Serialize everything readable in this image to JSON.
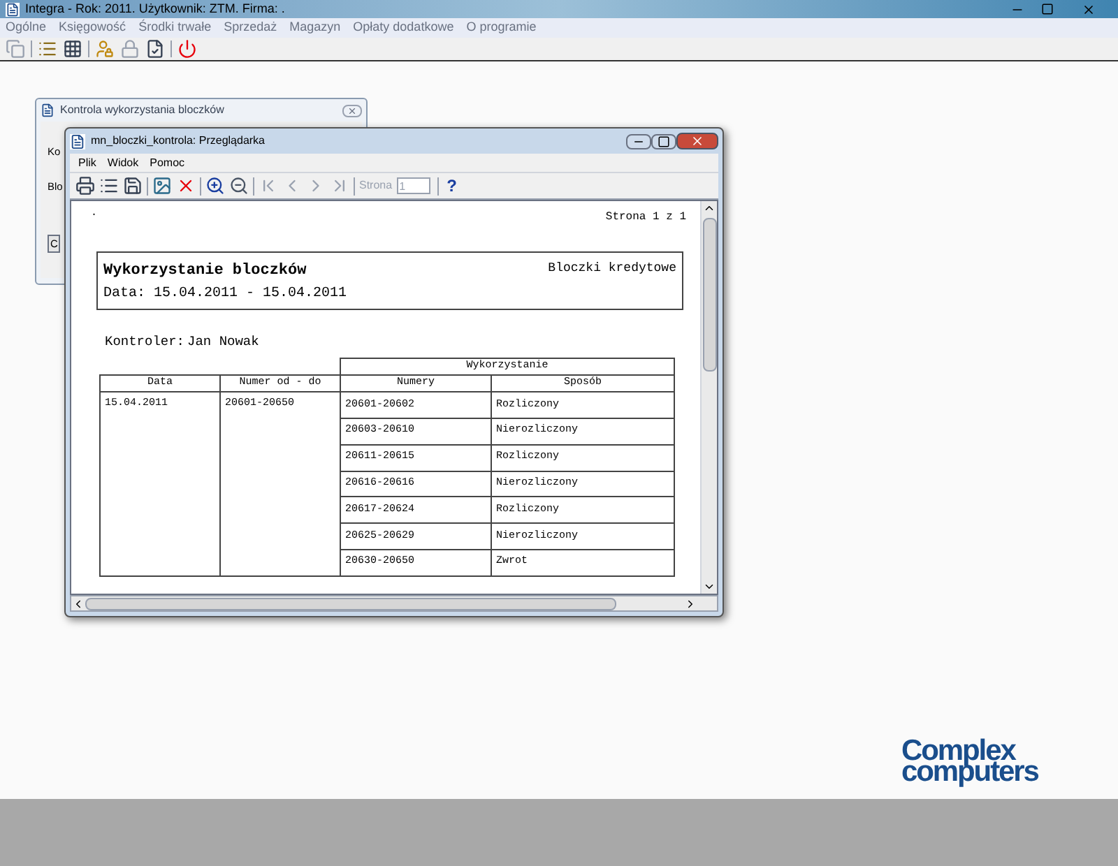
{
  "window": {
    "title": "Integra -  Rok: 2011. Użytkownik: ZTM. Firma: ."
  },
  "menu": [
    "Ogólne",
    "Księgowość",
    "Środki trwałe",
    "Sprzedaż",
    "Magazyn",
    "Opłaty dodatkowe",
    "O programie"
  ],
  "background_dialog": {
    "title": "Kontrola wykorzystania bloczków",
    "labels": [
      "Ko",
      "Blo"
    ],
    "button": "C"
  },
  "preview": {
    "title": "mn_bloczki_kontrola: Przeglądarka",
    "menu": [
      "Plik",
      "Widok",
      "Pomoc"
    ],
    "navigation": {
      "disabled": true
    },
    "page_label": "Strona",
    "page_value": "1",
    "help": "?",
    "report": {
      "mark": ".",
      "page_info": "Strona 1 z 1",
      "title": "Wykorzystanie bloczków",
      "type": "Bloczki kredytowe",
      "date": "Data: 15.04.2011 - 15.04.2011",
      "controller_label": "Kontroler:",
      "controller": "Jan Nowak",
      "group": "Wykorzystanie",
      "columns": [
        "Data",
        "Numer od - do",
        "Numery",
        "Sposób"
      ],
      "date_value": "15.04.2011",
      "range": "20601-20650",
      "rows": [
        {
          "numbers": "20601-20602",
          "method": "Rozliczony"
        },
        {
          "numbers": "20603-20610",
          "method": "Nierozliczony"
        },
        {
          "numbers": "20611-20615",
          "method": "Rozliczony"
        },
        {
          "numbers": "20616-20616",
          "method": "Nierozliczony"
        },
        {
          "numbers": "20617-20624",
          "method": "Rozliczony"
        },
        {
          "numbers": "20625-20629",
          "method": "Nierozliczony"
        },
        {
          "numbers": "20630-20650",
          "method": "Zwrot"
        }
      ]
    }
  },
  "logo": [
    "Complex",
    "computers"
  ]
}
